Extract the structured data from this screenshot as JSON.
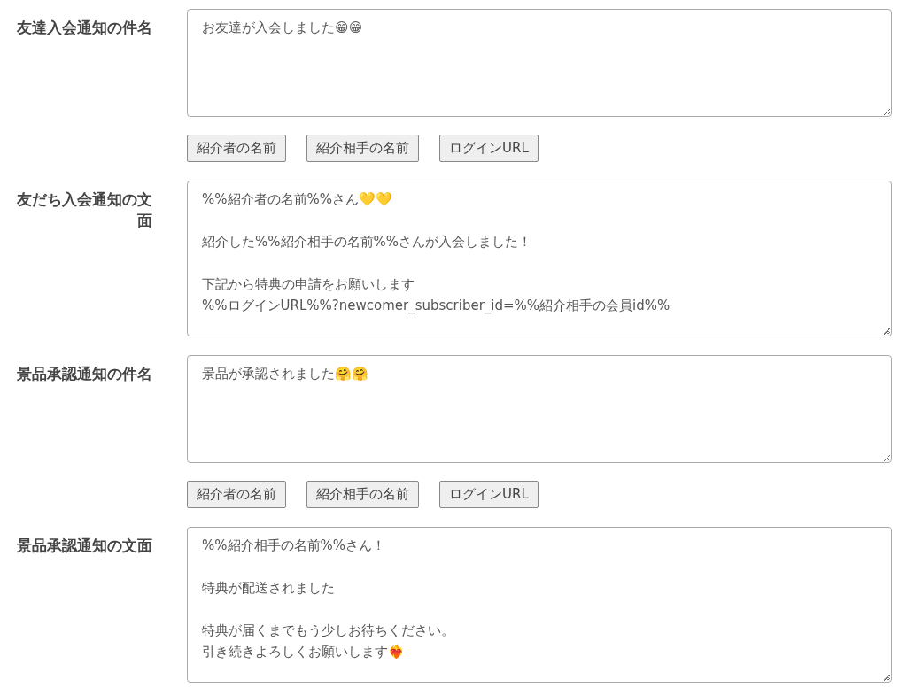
{
  "fields": [
    {
      "label": "友達入会通知の件名",
      "value": "お友達が入会しました😁😁",
      "inserts": [
        "紹介者の名前",
        "紹介相手の名前",
        "ログインURL"
      ],
      "kind": "subject"
    },
    {
      "label": "友だち入会通知の文面",
      "paragraphs": [
        [
          "%%紹介者の名前%%さん💛💛"
        ],
        [
          "紹介した%%紹介相手の名前%%さんが入会しました！"
        ],
        [
          "下記から特典の申請をお願いします",
          "%%ログインURL%%?newcomer_subscriber_id=%%紹介相手の会員id%%"
        ]
      ],
      "kind": "body"
    },
    {
      "label": "景品承認通知の件名",
      "value": "景品が承認されました🤗🤗",
      "inserts": [
        "紹介者の名前",
        "紹介相手の名前",
        "ログインURL"
      ],
      "kind": "subject"
    },
    {
      "label": "景品承認通知の文面",
      "paragraphs": [
        [
          "%%紹介相手の名前%%さん！"
        ],
        [
          "特典が配送されました"
        ],
        [
          "特典が届くまでもう少しお待ちください。",
          "引き続きよろしくお願いします❤️‍🔥"
        ]
      ],
      "kind": "body"
    }
  ]
}
